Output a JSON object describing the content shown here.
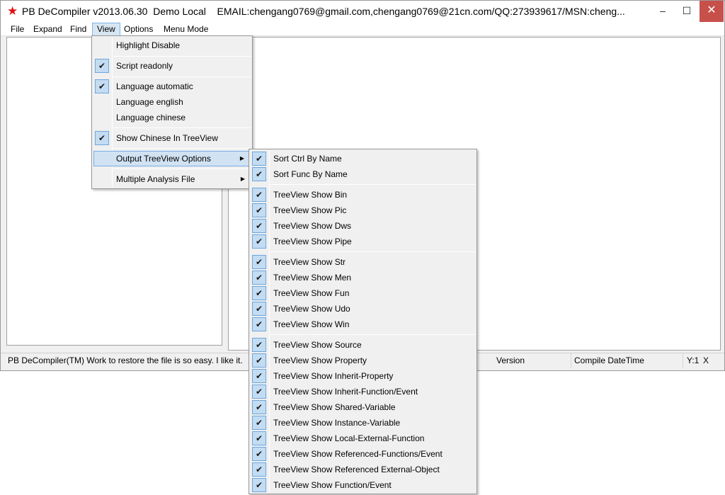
{
  "window": {
    "title": "PB DeCompiler v2013.06.30  Demo Local    EMAIL:chengang0769@gmail.com,chengang0769@21cn.com/QQ:273939617/MSN:cheng...",
    "min_glyph": "–",
    "max_glyph": "☐",
    "close_glyph": "✕",
    "accent_color": "#7eb4ea"
  },
  "menubar": {
    "items": [
      "File",
      "Expand",
      "Find",
      "View",
      "Options",
      "Menu Mode"
    ]
  },
  "view_menu": {
    "items": [
      {
        "label": "Highlight Disable",
        "checked": false
      },
      {
        "label": "Script readonly",
        "checked": true
      },
      {
        "label": "Language automatic",
        "checked": true
      },
      {
        "label": "Language english",
        "checked": false
      },
      {
        "label": "Language chinese",
        "checked": false
      },
      {
        "label": "Show Chinese In TreeView",
        "checked": true
      },
      {
        "label": "Output TreeView Options",
        "checked": false,
        "submenu": true
      },
      {
        "label": "Multiple Analysis File",
        "checked": false,
        "submenu": true
      }
    ]
  },
  "submenu": {
    "items": [
      "Sort Ctrl By Name",
      "Sort Func By Name",
      "TreeView Show Bin",
      "TreeView Show Pic",
      "TreeView Show Dws",
      "TreeView Show Pipe",
      "TreeView Show Str",
      "TreeView Show Men",
      "TreeView Show Fun",
      "TreeView Show Udo",
      "TreeView Show Win",
      "TreeView Show Source",
      "TreeView Show Property",
      "TreeView Show Inherit-Property",
      "TreeView Show Inherit-Function/Event",
      "TreeView Show Shared-Variable",
      "TreeView Show Instance-Variable",
      "TreeView Show Local-External-Function",
      "TreeView Show Referenced-Functions/Event",
      "TreeView Show Referenced External-Object",
      "TreeView Show Function/Event"
    ]
  },
  "statusbar": {
    "message": "PB DeCompiler(TM)  Work to restore the file is so easy. I like it.",
    "col_partial": "n",
    "version": "Version",
    "compile_datetime": "Compile DateTime",
    "y": "Y:1",
    "x": "X"
  },
  "icons": {
    "app": "★",
    "check": "✔",
    "submenu_arrow": "▶"
  }
}
